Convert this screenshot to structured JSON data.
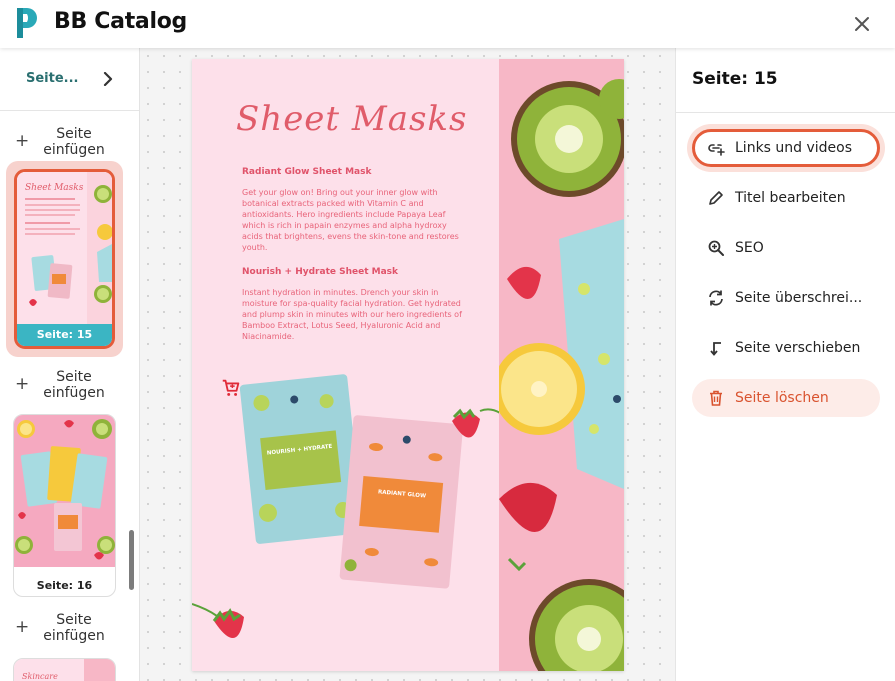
{
  "app": {
    "title": "BB Catalog",
    "accent": "#e45c3a",
    "teal": "#3bb5c3"
  },
  "sidebar": {
    "page_selector_label": "Seite...",
    "insert_label_line1": "Seite",
    "insert_label_line2": "einfügen",
    "thumbnails": [
      {
        "label": "Seite: 15",
        "active": true
      },
      {
        "label": "Seite: 16",
        "active": false
      }
    ]
  },
  "page": {
    "title": "Sheet Masks",
    "sections": [
      {
        "heading": "Radiant Glow Sheet Mask",
        "text": "Get your glow on! Bring out your inner glow with botanical extracts packed with Vitamin C and antioxidants. Hero ingredients include Papaya Leaf which is rich in papain enzymes and alpha hydroxy acids that brightens, evens the skin-tone and restores youth."
      },
      {
        "heading": "Nourish + Hydrate Sheet Mask",
        "text": "Instant hydration in minutes. Drench your skin in moisture for spa-quality facial hydration. Get hydrated and plump skin in minutes with our hero ingredients of Bamboo Extract, Lotus Seed, Hyaluronic Acid and Niacinamide."
      }
    ],
    "pack_labels": [
      "NOURISH + HYDRATE",
      "RADIANT GLOW"
    ]
  },
  "panel": {
    "title": "Seite: 15",
    "items": [
      {
        "label": "Links und videos",
        "icon": "link-add-icon"
      },
      {
        "label": "Titel bearbeiten",
        "icon": "pencil-icon"
      },
      {
        "label": "SEO",
        "icon": "search-zoom-icon"
      },
      {
        "label": "Seite überschrei...",
        "icon": "replace-icon"
      },
      {
        "label": "Seite verschieben",
        "icon": "move-arrow-icon"
      },
      {
        "label": "Seite löschen",
        "icon": "trash-icon"
      }
    ]
  }
}
